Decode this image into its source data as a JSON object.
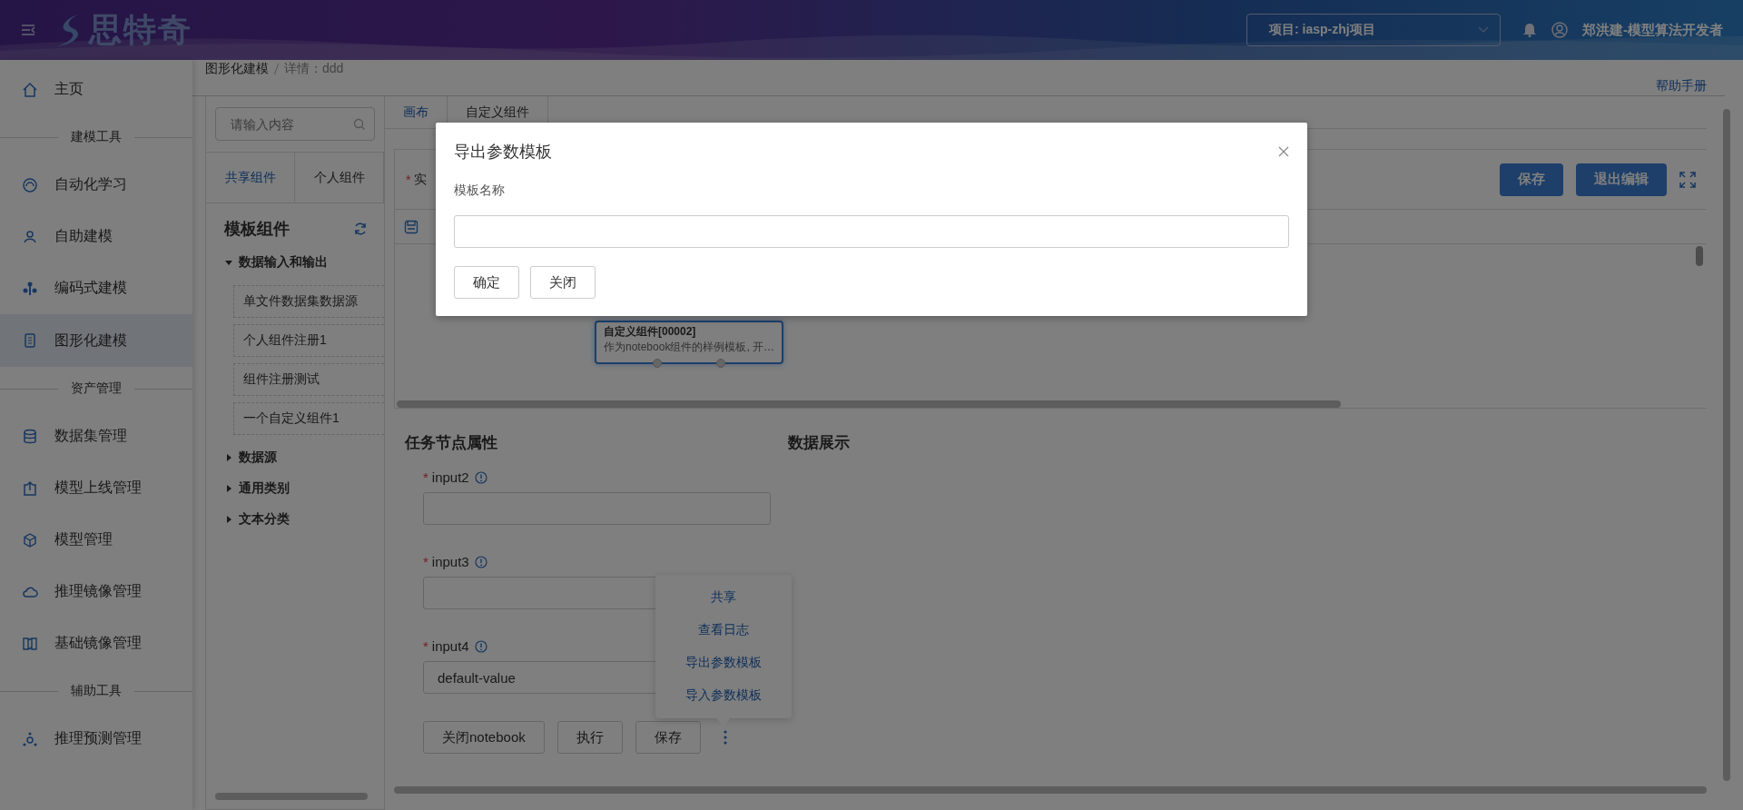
{
  "header": {
    "logo": "思特奇",
    "project_select": {
      "label": "项目: iasp-zhj项目"
    },
    "user": "郑洪建-模型算法开发者"
  },
  "sidebar": {
    "items": [
      {
        "kind": "item",
        "label": "主页",
        "selected": false
      },
      {
        "kind": "section",
        "label": "建模工具"
      },
      {
        "kind": "item",
        "label": "自动化学习",
        "selected": false
      },
      {
        "kind": "item",
        "label": "自助建模",
        "selected": false
      },
      {
        "kind": "item",
        "label": "编码式建模",
        "selected": false
      },
      {
        "kind": "item",
        "label": "图形化建模",
        "selected": true
      },
      {
        "kind": "section",
        "label": "资产管理"
      },
      {
        "kind": "item",
        "label": "数据集管理",
        "selected": false
      },
      {
        "kind": "item",
        "label": "模型上线管理",
        "selected": false
      },
      {
        "kind": "item",
        "label": "模型管理",
        "selected": false
      },
      {
        "kind": "item",
        "label": "推理镜像管理",
        "selected": false
      },
      {
        "kind": "item",
        "label": "基础镜像管理",
        "selected": false
      },
      {
        "kind": "section",
        "label": "辅助工具"
      },
      {
        "kind": "item",
        "label": "推理预测管理",
        "selected": false
      }
    ]
  },
  "breadcrumb": [
    "图形化建模",
    "详情：ddd"
  ],
  "help_link": "帮助手册",
  "component_panel": {
    "search": {
      "placeholder": "请输入内容"
    },
    "tabs": [
      {
        "label": "共享组件",
        "selected": true
      },
      {
        "label": "个人组件",
        "selected": false
      }
    ],
    "title": "模板组件",
    "tree": [
      {
        "label": "数据输入和输出",
        "expanded": true,
        "children": [
          {
            "label": "单文件数据集数据源"
          },
          {
            "label": "个人组件注册1"
          },
          {
            "label": "组件注册测试"
          },
          {
            "label": "一个自定义组件1"
          }
        ]
      },
      {
        "label": "数据源",
        "expanded": false
      },
      {
        "label": "通用类别",
        "expanded": false
      },
      {
        "label": "文本分类",
        "expanded": false
      }
    ]
  },
  "main_tabs": [
    {
      "label": "画布",
      "selected": true
    },
    {
      "label": "自定义组件",
      "selected": false
    }
  ],
  "canvas": {
    "field_required_mark": "*",
    "field_label": "实",
    "buttons": [
      "保存",
      "退出编辑"
    ],
    "node": {
      "title": "自定义组件[00002]",
      "description": "作为notebook组件的样例模板, 开…"
    }
  },
  "properties": {
    "title": "任务节点属性",
    "fields": [
      {
        "required_mark": "*",
        "label": "input2"
      },
      {
        "required_mark": "*",
        "label": "input3"
      },
      {
        "required_mark": "*",
        "label": "input4",
        "value": "default-value"
      }
    ],
    "buttons": [
      "关闭notebook",
      "执行",
      "保存"
    ],
    "more_menu": {
      "open": true,
      "items": [
        "共享",
        "查看日志",
        "导出参数模板",
        "导入参数模板"
      ]
    }
  },
  "data_display": {
    "title": "数据展示"
  },
  "dialog": {
    "open": true,
    "title": "导出参数模板",
    "field_label": "模板名称",
    "buttons": [
      "确定",
      "关闭"
    ]
  }
}
